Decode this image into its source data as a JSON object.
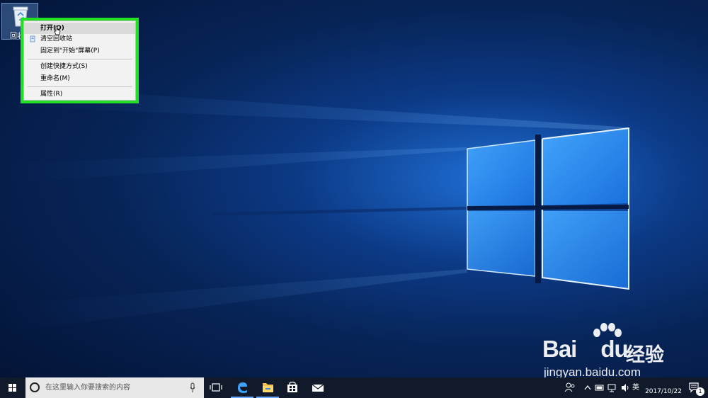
{
  "desktop": {
    "recycle_bin_label": "回收站"
  },
  "context_menu": {
    "items": [
      {
        "label": "打开(O)"
      },
      {
        "label": "清空回收站"
      },
      {
        "label": "固定到\"开始\"屏幕(P)"
      },
      {
        "label": "创建快捷方式(S)"
      },
      {
        "label": "重命名(M)"
      },
      {
        "label": "属性(R)"
      }
    ]
  },
  "watermark": {
    "brand": "Bai",
    "brand_du": "du",
    "product": "经验",
    "url": "jingyan.baidu.com"
  },
  "taskbar": {
    "search_placeholder": "在这里输入你要搜索的内容",
    "input_language": "英",
    "clock_time": "",
    "clock_date": "2017/10/22",
    "notification_count": "1"
  },
  "colors": {
    "highlight_border": "#22e022",
    "taskbar_bg": "#101a2b",
    "menu_bg": "#f2f2f2"
  },
  "icons": [
    "recycle-bin-icon",
    "windows-logo-icon",
    "cortana-icon",
    "microphone-icon",
    "task-view-icon",
    "edge-icon",
    "file-explorer-icon",
    "store-icon",
    "mail-icon",
    "people-icon",
    "chevron-up-icon",
    "battery-icon",
    "network-icon",
    "volume-icon",
    "notification-icon"
  ]
}
